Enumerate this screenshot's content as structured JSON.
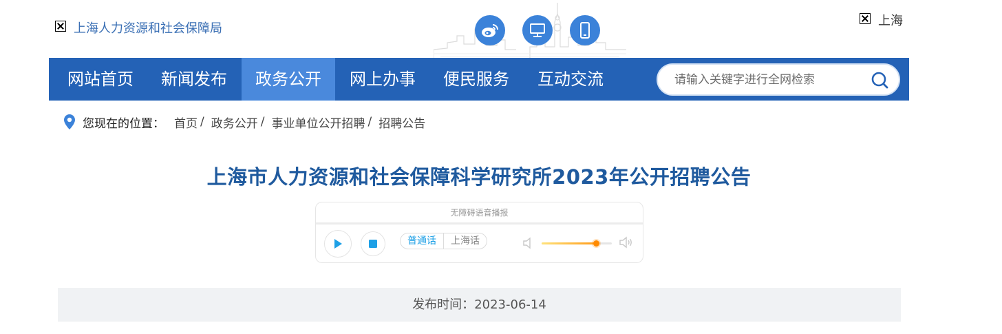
{
  "header": {
    "site_name": "上海人力资源和社会保障局",
    "city": "上海",
    "icons": [
      "weibo-icon",
      "desktop-icon",
      "mobile-icon"
    ]
  },
  "nav": {
    "items": [
      {
        "label": "网站首页"
      },
      {
        "label": "新闻发布"
      },
      {
        "label": "政务公开",
        "active": true
      },
      {
        "label": "网上办事"
      },
      {
        "label": "便民服务"
      },
      {
        "label": "互动交流"
      }
    ],
    "search_placeholder": "请输入关键字进行全网检索"
  },
  "breadcrumb": {
    "label": "您现在的位置：",
    "items": [
      "首页",
      "政务公开",
      "事业单位公开招聘",
      "招聘公告"
    ],
    "separator": "/"
  },
  "article": {
    "title": "上海市人力资源和社会保障科学研究所2023年公开招聘公告",
    "publish_label": "发布时间：",
    "publish_date": "2023-06-14"
  },
  "player": {
    "title": "无障碍语音播报",
    "languages": [
      "普通话",
      "上海话"
    ],
    "active_language": "普通话",
    "volume": 0.77
  },
  "colors": {
    "nav_bg": "#2462b6",
    "nav_active": "#4a89dc",
    "title": "#1f5a9e",
    "accent_blue": "#3b82d9",
    "player_blue": "#1ea0e6",
    "volume_orange": "#ff8a00"
  }
}
